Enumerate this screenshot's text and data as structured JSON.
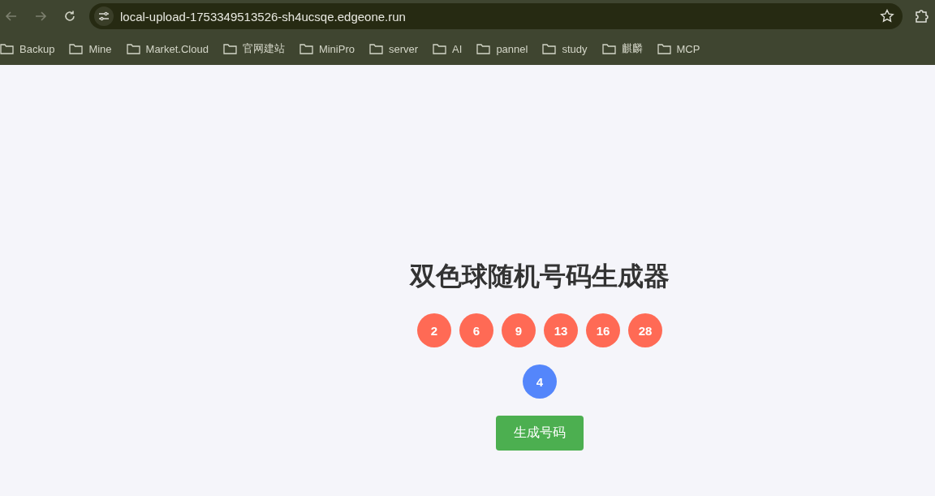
{
  "browser": {
    "url": "local-upload-1753349513526-sh4ucsqe.edgeone.run",
    "bookmarks": [
      "Backup",
      "Mine",
      "Market.Cloud",
      "官网建站",
      "MiniPro",
      "server",
      "AI",
      "pannel",
      "study",
      "麒麟",
      "MCP"
    ]
  },
  "page": {
    "title": "双色球随机号码生成器",
    "red_balls": [
      {
        "number": "2",
        "kind": "red"
      },
      {
        "number": "6",
        "kind": "red"
      },
      {
        "number": "9",
        "kind": "red"
      },
      {
        "number": "13",
        "kind": "red"
      },
      {
        "number": "16",
        "kind": "red"
      },
      {
        "number": "28",
        "kind": "red"
      }
    ],
    "blue_balls": [
      {
        "number": "4",
        "kind": "blue"
      }
    ],
    "button": "生成号码"
  }
}
